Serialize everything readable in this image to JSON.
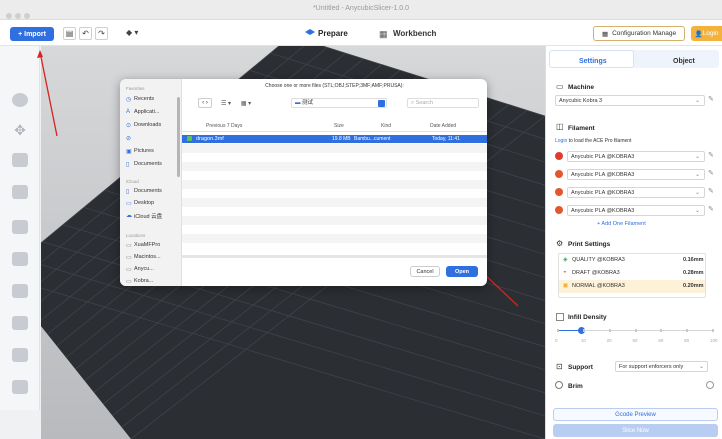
{
  "window": {
    "title": "*Untitled - AnycubicSlicer-1.0.0"
  },
  "toolbar": {
    "import_label": "+ Import",
    "tab_prepare": "Prepare",
    "tab_workbench": "Workbench",
    "config_label": "Configuration Manage",
    "login_label": "Login"
  },
  "right_panel": {
    "tab_settings": "Settings",
    "tab_object": "Object",
    "machine_heading": "Machine",
    "machine_value": "Anycubic Kobra 3",
    "filament_heading": "Filament",
    "filament_login_link": "Login",
    "filament_login_text": " to load the ACE Pro filament",
    "filaments": [
      {
        "name": "Anycubic PLA @KOBRA3",
        "color": "#e23b2e"
      },
      {
        "name": "Anycubic PLA @KOBRA3",
        "color": "#e2582e"
      },
      {
        "name": "Anycubic PLA @KOBRA3",
        "color": "#e2582e"
      },
      {
        "name": "Anycubic PLA @KOBRA3",
        "color": "#e2582e"
      }
    ],
    "add_filament": "+ Add One Filament",
    "print_settings_heading": "Print Settings",
    "print_settings": [
      {
        "name": "QUALITY @KOBRA3",
        "value": "0.16mm"
      },
      {
        "name": "DRAFT @KOBRA3",
        "value": "0.28mm"
      },
      {
        "name": "NORMAL @KOBRA3",
        "value": "0.20mm"
      }
    ],
    "infill_heading": "Infill Density",
    "infill_ticks": [
      "0",
      "10",
      "20",
      "50",
      "60",
      "80",
      "100"
    ],
    "infill_value": 0.15,
    "support_label": "Support",
    "support_value": "For support enforcers only",
    "brim_label": "Brim",
    "gcode_preview": "Gcode Preview",
    "slice_now": "Slice Now"
  },
  "dialog": {
    "title": "Choose one or more files (STL;OBJ;STEP;3MF;AMF;PRUSA):",
    "favorites_heading": "Favorites",
    "favorites": [
      "Recents",
      "Applicati...",
      "Downloads",
      "",
      "Pictures",
      "Documents"
    ],
    "icloud_heading": "iCloud",
    "icloud": [
      "Documents",
      "Desktop",
      "iCloud 云盘"
    ],
    "locations_heading": "Locations",
    "locations": [
      "XuaMFPro",
      "Macintos...",
      "Anycu...",
      "Kobra..."
    ],
    "folder": "测试",
    "search_placeholder": "Search",
    "group_header": "Previous 7 Days",
    "col_size": "Size",
    "col_kind": "Kind",
    "col_date": "Date Added",
    "file": {
      "name": "dragon.3mf",
      "size": "19.8 MB",
      "kind": "Bambu...cument",
      "date": "Today, 11:41"
    },
    "cancel": "Cancel",
    "open": "Open"
  },
  "colors": {
    "accent": "#2f6fe0",
    "login": "#f3b23c",
    "annotation": "#d9231d"
  }
}
